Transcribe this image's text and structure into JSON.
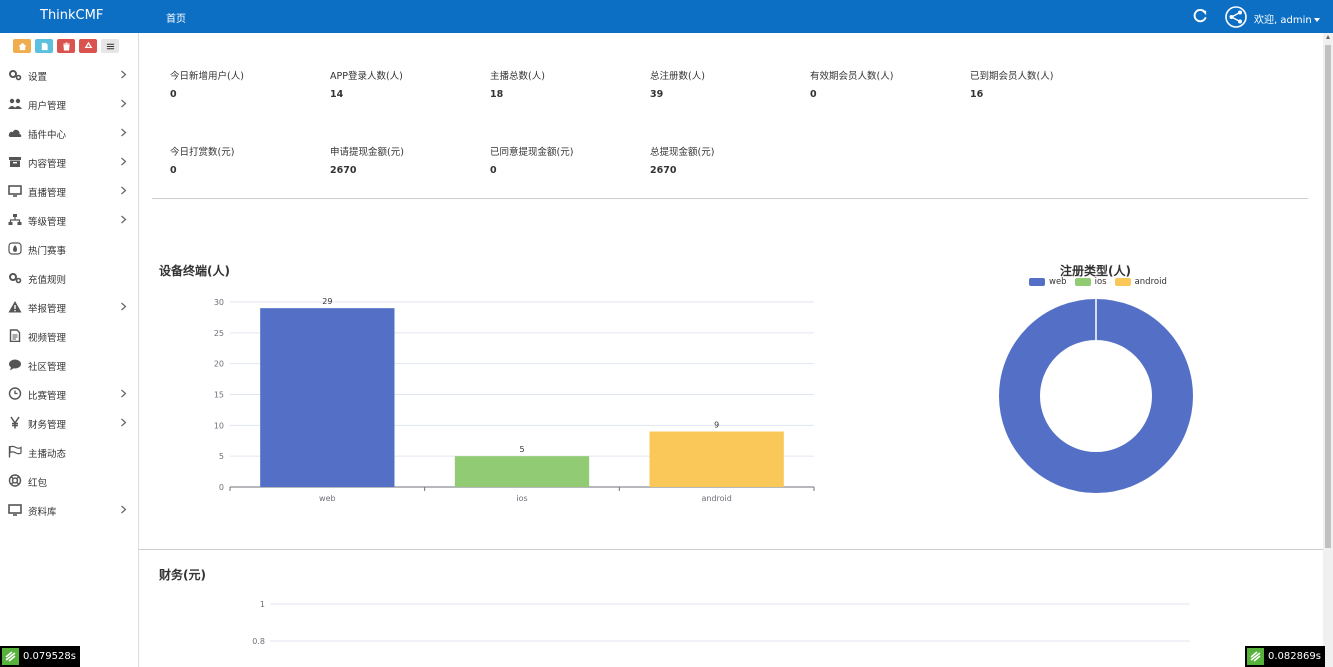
{
  "header": {
    "brand": "ThinkCMF",
    "tab_home": "首页",
    "welcome": "欢迎, admin"
  },
  "sidebar": {
    "tools": [
      {
        "icon": "home-icon",
        "color": "#f0ad4e"
      },
      {
        "icon": "file-icon",
        "color": "#5bc0de"
      },
      {
        "icon": "trash-icon",
        "color": "#d9534f"
      },
      {
        "icon": "recycle-icon",
        "color": "#d9534f"
      },
      {
        "icon": "menu-icon",
        "color": "#e6e6e6"
      }
    ],
    "items": [
      {
        "label": "设置",
        "icon": "gears-icon",
        "has_children": true
      },
      {
        "label": "用户管理",
        "icon": "users-icon",
        "has_children": true
      },
      {
        "label": "插件中心",
        "icon": "cloud-icon",
        "has_children": true
      },
      {
        "label": "内容管理",
        "icon": "archive-icon",
        "has_children": true
      },
      {
        "label": "直播管理",
        "icon": "monitor-icon",
        "has_children": true
      },
      {
        "label": "等级管理",
        "icon": "sitemap-icon",
        "has_children": true
      },
      {
        "label": "热门赛事",
        "icon": "fire-icon",
        "has_children": false
      },
      {
        "label": "充值规则",
        "icon": "gears-icon",
        "has_children": false
      },
      {
        "label": "举报管理",
        "icon": "warning-icon",
        "has_children": true
      },
      {
        "label": "视频管理",
        "icon": "file-text-icon",
        "has_children": false
      },
      {
        "label": "社区管理",
        "icon": "comment-icon",
        "has_children": false
      },
      {
        "label": "比赛管理",
        "icon": "clock-icon",
        "has_children": true
      },
      {
        "label": "财务管理",
        "icon": "yen-icon",
        "has_children": true
      },
      {
        "label": "主播动态",
        "icon": "flag-icon",
        "has_children": false
      },
      {
        "label": "红包",
        "icon": "lifebuoy-icon",
        "has_children": false
      },
      {
        "label": "资料库",
        "icon": "monitor-icon",
        "has_children": true
      }
    ]
  },
  "stats_row1": [
    {
      "label": "今日新增用户(人)",
      "value": "0"
    },
    {
      "label": "APP登录人数(人)",
      "value": "14"
    },
    {
      "label": "主播总数(人)",
      "value": "18"
    },
    {
      "label": "总注册数(人)",
      "value": "39"
    },
    {
      "label": "有效期会员人数(人)",
      "value": "0"
    },
    {
      "label": "已到期会员人数(人)",
      "value": "16"
    }
  ],
  "stats_row2": [
    {
      "label": "今日打赏数(元)",
      "value": "0"
    },
    {
      "label": "申请提现金额(元)",
      "value": "2670"
    },
    {
      "label": "已同意提现金额(元)",
      "value": "0"
    },
    {
      "label": "总提现金额(元)",
      "value": "2670"
    }
  ],
  "charts": {
    "device_title": "设备终端(人)",
    "register_title": "注册类型(人)",
    "finance_title": "财务(元)"
  },
  "chart_data": [
    {
      "type": "bar",
      "title": "设备终端(人)",
      "categories": [
        "web",
        "ios",
        "android"
      ],
      "values": [
        29,
        5,
        9
      ],
      "colors": [
        "#5470c6",
        "#91cc75",
        "#fac858"
      ],
      "ylim": [
        0,
        30
      ],
      "yticks": [
        0,
        5,
        10,
        15,
        20,
        25,
        30
      ],
      "grid": true
    },
    {
      "type": "pie",
      "title": "注册类型(人)",
      "labels": [
        "web",
        "ios",
        "android"
      ],
      "values": [
        39,
        0,
        0
      ],
      "colors": [
        "#5470c6",
        "#91cc75",
        "#fac858"
      ],
      "legend": "top"
    },
    {
      "type": "line",
      "title": "财务(元)",
      "yticks": [
        1,
        0.8
      ],
      "grid": true
    }
  ],
  "timers": {
    "left": "0.079528s",
    "right": "0.082869s"
  }
}
